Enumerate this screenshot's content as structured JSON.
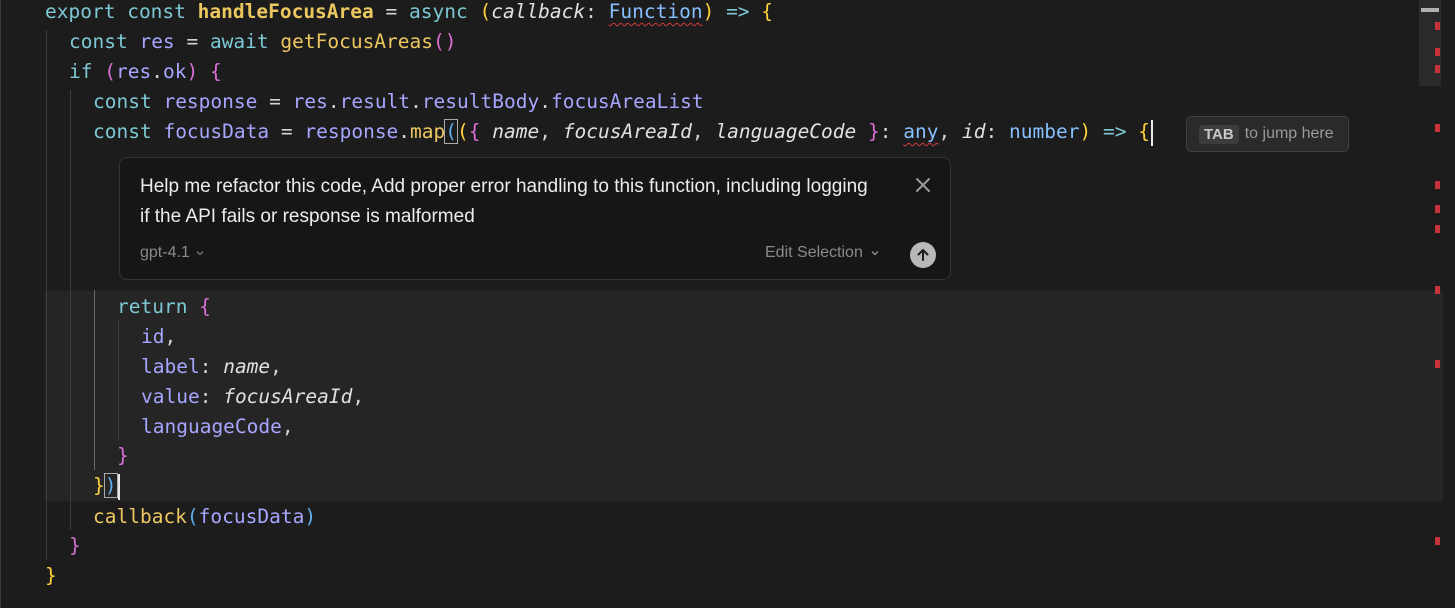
{
  "code": {
    "l1": {
      "export": "export",
      "const": "const",
      "name": "handleFocusArea",
      "eq": "=",
      "async": "async",
      "param": "callback",
      "colon": ":",
      "type": "Function",
      "arrow": "=>",
      "brace": "{"
    },
    "l2": {
      "const": "const",
      "res": "res",
      "eq": "=",
      "await": "await",
      "call": "getFocusAreas",
      "parens": "()"
    },
    "l3": {
      "if": "if",
      "res": "res",
      "dot": ".",
      "ok": "ok",
      "brace": "{"
    },
    "l4": {
      "const": "const",
      "response": "response",
      "eq": "=",
      "res": "res",
      "result": "result",
      "resultBody": "resultBody",
      "focusAreaList": "focusAreaList"
    },
    "l5": {
      "const": "const",
      "focusData": "focusData",
      "eq": "=",
      "response": "response",
      "map": "map",
      "p_name": "name",
      "p_focusAreaId": "focusAreaId",
      "p_languageCode": "languageCode",
      "any": "any",
      "id": "id",
      "number": "number",
      "arrow": "=>"
    },
    "l10": {
      "return": "return"
    },
    "l11": {
      "id": "id"
    },
    "l12": {
      "key": "label",
      "val": "name"
    },
    "l13": {
      "key": "value",
      "val": "focusAreaId"
    },
    "l14": {
      "key": "languageCode"
    },
    "l17": {
      "callback": "callback",
      "arg": "focusData"
    }
  },
  "tab_hint": {
    "key": "TAB",
    "label": "to jump here"
  },
  "prompt": {
    "text": "Help me refactor this code, Add proper error handling to this function, including logging if the API fails or response is malformed",
    "model": "gpt-4.1",
    "mode": "Edit Selection",
    "close_icon": "close-icon",
    "submit_icon": "arrow-up-icon"
  },
  "colors": {
    "background": "#1c1c1c",
    "error": "#c8323a",
    "accent_yellow": "#ecc75f"
  }
}
